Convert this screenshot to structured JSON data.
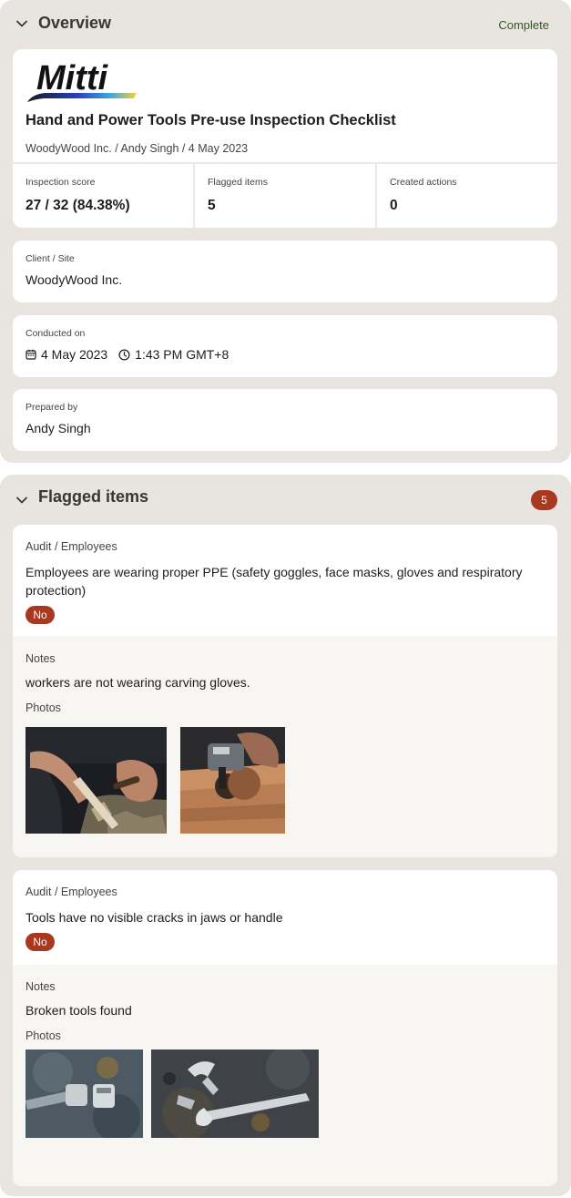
{
  "overview": {
    "title": "Overview",
    "status": "Complete",
    "logo_text": "Mitti",
    "doc_title": "Hand and Power Tools Pre-use Inspection Checklist",
    "meta": "WoodyWood Inc. / Andy Singh / 4 May 2023",
    "stats": [
      {
        "label": "Inspection score",
        "value": "27 / 32 (84.38%)"
      },
      {
        "label": "Flagged items",
        "value": "5"
      },
      {
        "label": "Created actions",
        "value": "0"
      }
    ],
    "client": {
      "label": "Client / Site",
      "value": "WoodyWood Inc."
    },
    "conducted": {
      "label": "Conducted on",
      "date": "4 May 2023",
      "time": "1:43 PM GMT+8"
    },
    "prepared": {
      "label": "Prepared by",
      "value": "Andy Singh"
    }
  },
  "flagged": {
    "title": "Flagged items",
    "count": "5",
    "items": [
      {
        "path": "Audit / Employees",
        "question": "Employees are wearing proper PPE (safety goggles, face masks, gloves and respiratory protection)",
        "answer": "No",
        "notes_label": "Notes",
        "notes": "workers are not wearing carving gloves.",
        "photos_label": "Photos",
        "photos": [
          "hands-carving-wood-photo",
          "angle-grinder-on-wood-photo"
        ]
      },
      {
        "path": "Audit / Employees",
        "question": "Tools have no visible cracks in jaws or handle",
        "answer": "No",
        "notes_label": "Notes",
        "notes": "Broken tools found",
        "photos_label": "Photos",
        "photos": [
          "broken-socket-wrench-photo",
          "broken-adjustable-wrench-photo"
        ]
      }
    ]
  },
  "colors": {
    "accent_red": "#a8381f",
    "status_green": "#2e5a1e",
    "section_bg": "#e8e4df"
  }
}
